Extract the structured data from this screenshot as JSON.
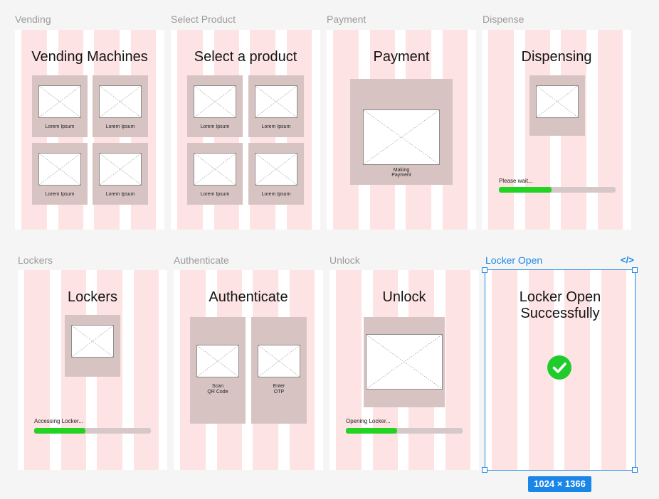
{
  "colors": {
    "canvas": "#f5f5f5",
    "frame_bg": "#ffffff",
    "grid_column": "#fde3e3",
    "card": "#d8c3c3",
    "progress_track": "#d6c8c8",
    "progress_fill": "#22d322",
    "selection": "#1a86e8",
    "success_icon": "#1fcc2c"
  },
  "frames": {
    "vending": {
      "label": "Vending",
      "title": "Vending Machines",
      "cards": [
        {
          "caption": "Lorem Ipsum"
        },
        {
          "caption": "Lorem Ipsum"
        },
        {
          "caption": "Lorem Ipsum"
        },
        {
          "caption": "Lorem Ipsum"
        }
      ]
    },
    "select_product": {
      "label": "Select Product",
      "title": "Select a product",
      "cards": [
        {
          "caption": "Lorem Ipsum"
        },
        {
          "caption": "Lorem Ipsum"
        },
        {
          "caption": "Lorem Ipsum"
        },
        {
          "caption": "Lorem Ipsum"
        }
      ]
    },
    "payment": {
      "label": "Payment",
      "title": "Payment",
      "caption_line1": "Making",
      "caption_line2": "Payment"
    },
    "dispense": {
      "label": "Dispense",
      "title": "Dispensing",
      "progress_text": "Please wait...",
      "progress": 0.45
    },
    "lockers": {
      "label": "Lockers",
      "title": "Lockers",
      "progress_text": "Accessing Locker...",
      "progress": 0.44
    },
    "authenticate": {
      "label": "Authenticate",
      "title": "Authenticate",
      "options": [
        {
          "line1": "Scan",
          "line2": "QR Code"
        },
        {
          "line1": "Enter",
          "line2": "OTP"
        }
      ]
    },
    "unlock": {
      "label": "Unlock",
      "title": "Unlock",
      "progress_text": "Opening Locker...",
      "progress": 0.44
    },
    "locker_open": {
      "label": "Locker Open",
      "title_line1": "Locker Open",
      "title_line2": "Successfully",
      "icon": "check-circle-icon",
      "dimensions": "1024 × 1366",
      "code_icon": "</>"
    }
  }
}
